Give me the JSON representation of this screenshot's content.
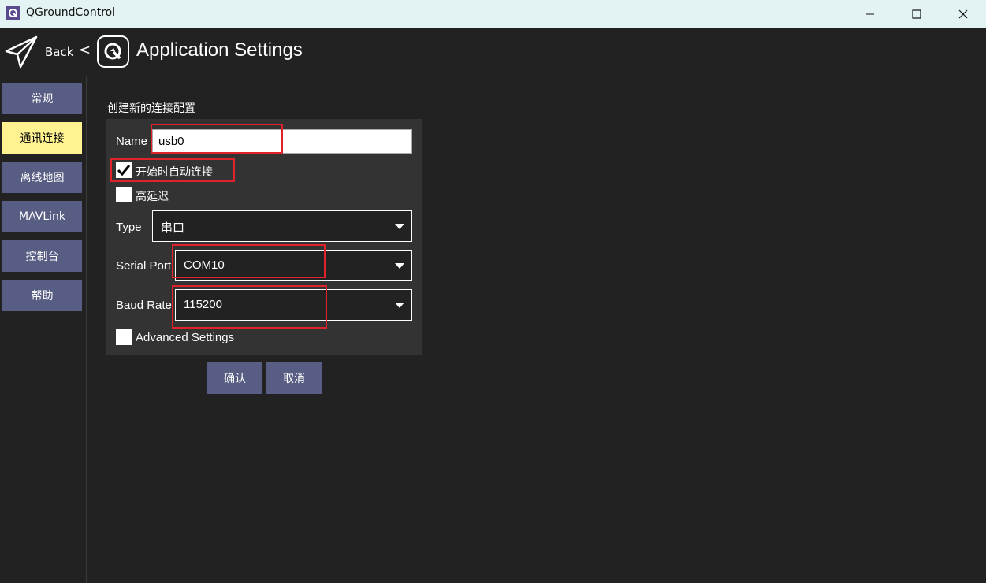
{
  "window": {
    "title": "QGroundControl"
  },
  "header": {
    "back_label": "Back",
    "back_chevron": "<",
    "title": "Application Settings"
  },
  "sidebar": {
    "items": [
      {
        "label": "常规",
        "active": false
      },
      {
        "label": "通讯连接",
        "active": true
      },
      {
        "label": "离线地图",
        "active": false
      },
      {
        "label": "MAVLink",
        "active": false
      },
      {
        "label": "控制台",
        "active": false
      },
      {
        "label": "帮助",
        "active": false
      }
    ]
  },
  "form": {
    "section_title": "创建新的连接配置",
    "name_label": "Name",
    "name_value": "usb0",
    "auto_connect_label": "开始时自动连接",
    "auto_connect_checked": true,
    "high_latency_label": "高延迟",
    "high_latency_checked": false,
    "type_label": "Type",
    "type_value": "串口",
    "serial_port_label": "Serial Port",
    "serial_port_value": "COM10",
    "baud_rate_label": "Baud Rate",
    "baud_rate_value": "115200",
    "advanced_label": "Advanced Settings",
    "advanced_checked": false
  },
  "buttons": {
    "confirm_label": "确认",
    "cancel_label": "取消"
  },
  "colors": {
    "background": "#222222",
    "panel": "#333333",
    "sidebar_button": "#585d83",
    "sidebar_active": "#fff291",
    "highlight": "#e0222a",
    "titlebar": "#e3f3f3"
  }
}
